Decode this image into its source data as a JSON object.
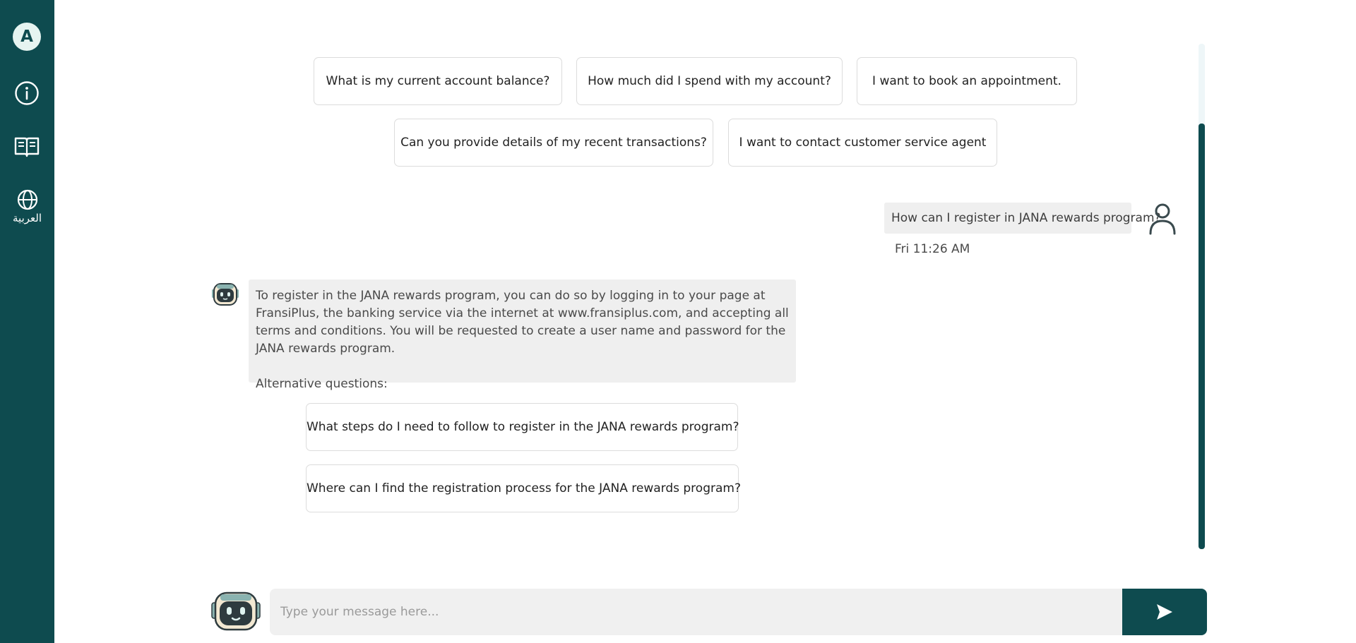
{
  "sidebar": {
    "avatar_letter": "A",
    "items": [
      {
        "icon": "info-icon"
      },
      {
        "icon": "book-icon"
      },
      {
        "icon": "globe-icon",
        "label": "العربية"
      }
    ]
  },
  "suggestions": [
    "What is my current account balance?",
    "How much did I spend with my account?",
    "I want to book an appointment.",
    "Can you provide details of my recent transactions?",
    "I want to contact customer service agent"
  ],
  "conversation": {
    "user_message": {
      "text": "How can I register in JANA rewards program?",
      "time": "Fri 11:26 AM"
    },
    "bot_message": {
      "text": "To register in the JANA rewards program, you can do so by logging in to your page at FransiPlus, the banking service via the internet at www.fransiplus.com, and accepting all terms and conditions. You will be requested to create a user name and password for the JANA rewards program.",
      "alternative_label": "Alternative questions:",
      "alternatives": [
        "What steps do I need to follow to register in the JANA rewards program?",
        "Where can I find the registration process for the JANA rewards program?"
      ]
    }
  },
  "composer": {
    "placeholder": "Type your message here..."
  },
  "colors": {
    "brand": "#0e4b4f",
    "bubble_bg": "#efefef"
  }
}
